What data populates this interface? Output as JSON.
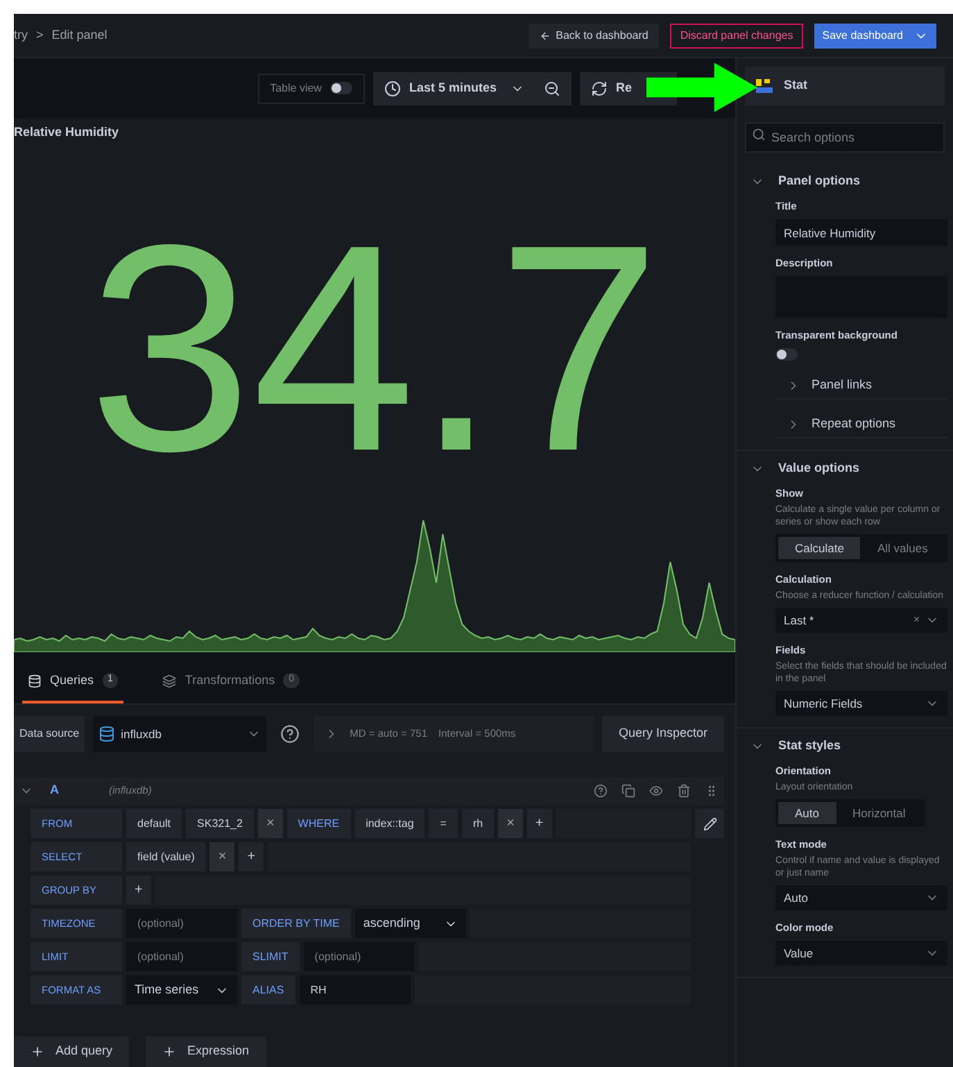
{
  "breadcrumb": {
    "parent": "try",
    "separator": ">",
    "current": "Edit panel"
  },
  "header_buttons": [
    {
      "kind": "back",
      "label": "Back to dashboard"
    },
    {
      "kind": "discard",
      "label": "Discard panel changes"
    },
    {
      "kind": "save",
      "label": "Save dashboard"
    }
  ],
  "toolbar": {
    "table_view": {
      "label": "Table view",
      "on": false
    },
    "time_range": "Last 5 minutes",
    "refresh": "Re"
  },
  "visualization": "Stat",
  "panel": {
    "title": "Relative Humidity",
    "value": "34.7"
  },
  "tabs": [
    {
      "label": "Queries",
      "count": "1",
      "selected": true
    },
    {
      "label": "Transformations",
      "count": "0",
      "selected": false
    }
  ],
  "data_source": {
    "label": "Data source",
    "name": "influxdb",
    "query_options": "MD = auto = 751",
    "interval": "Interval = 500ms",
    "inspector": "Query Inspector"
  },
  "query": {
    "ref": "A",
    "datasource": "(influxdb)",
    "expanded": true,
    "rows": [
      {
        "label": "FROM",
        "parts": [
          {
            "kind": "value",
            "text": "default"
          },
          {
            "kind": "value",
            "text": "SK321_2"
          },
          {
            "kind": "remove",
            "text": "×"
          },
          {
            "kind": "keyword",
            "text": "WHERE"
          },
          {
            "kind": "value",
            "text": "index::tag"
          },
          {
            "kind": "value",
            "text": "="
          },
          {
            "kind": "value",
            "text": "rh"
          },
          {
            "kind": "remove",
            "text": "×"
          },
          {
            "kind": "add",
            "text": "+"
          },
          {
            "kind": "edit"
          }
        ]
      },
      {
        "label": "SELECT",
        "parts": [
          {
            "kind": "value",
            "text": "field (value)"
          },
          {
            "kind": "remove",
            "text": "×"
          },
          {
            "kind": "add",
            "text": "+"
          }
        ]
      },
      {
        "label": "GROUP BY",
        "parts": [
          {
            "kind": "add",
            "text": "+"
          }
        ]
      },
      {
        "label": "TIMEZONE",
        "parts": [
          {
            "kind": "input",
            "placeholder": "(optional)"
          },
          {
            "kind": "keyword",
            "text": "ORDER BY TIME"
          },
          {
            "kind": "select",
            "text": "ascending"
          }
        ]
      },
      {
        "label": "LIMIT",
        "parts": [
          {
            "kind": "input",
            "placeholder": "(optional)"
          },
          {
            "kind": "keyword",
            "text": "SLIMIT"
          },
          {
            "kind": "input",
            "placeholder": "(optional)"
          }
        ]
      },
      {
        "label": "FORMAT AS",
        "parts": [
          {
            "kind": "select",
            "text": "Time series"
          },
          {
            "kind": "keyword",
            "text": "ALIAS"
          },
          {
            "kind": "input",
            "value": "RH"
          }
        ]
      }
    ]
  },
  "query_actions": [
    "Add query",
    "Expression"
  ],
  "options": {
    "search_placeholder": "Search options",
    "sections": [
      {
        "title": "Panel options",
        "expanded": true,
        "items": [
          {
            "kind": "text",
            "label": "Title",
            "value": "Relative Humidity"
          },
          {
            "kind": "textarea",
            "label": "Description"
          },
          {
            "kind": "switch",
            "label": "Transparent background",
            "on": false
          },
          {
            "kind": "group",
            "label": "Panel links",
            "expanded": false
          },
          {
            "kind": "group",
            "label": "Repeat options",
            "expanded": false
          }
        ]
      },
      {
        "title": "Value options",
        "expanded": true,
        "items": [
          {
            "kind": "radio",
            "label": "Show",
            "description": "Calculate a single value per column or series or show each row",
            "options": [
              {
                "label": "Calculate",
                "selected": true
              },
              {
                "label": "All values",
                "selected": false
              }
            ]
          },
          {
            "kind": "select",
            "label": "Calculation",
            "description": "Choose a reducer function / calculation",
            "value": "Last *",
            "clear": "×"
          },
          {
            "kind": "select",
            "label": "Fields",
            "description": "Select the fields that should be included in the panel",
            "value": "Numeric Fields"
          }
        ]
      },
      {
        "title": "Stat styles",
        "expanded": true,
        "items": [
          {
            "kind": "radio",
            "label": "Orientation",
            "description": "Layout orientation",
            "options": [
              {
                "label": "Auto",
                "selected": true
              },
              {
                "label": "Horizontal",
                "selected": false
              }
            ]
          },
          {
            "kind": "select",
            "label": "Text mode",
            "description": "Control if name and value is displayed or just name",
            "value": "Auto"
          },
          {
            "kind": "select",
            "label": "Color mode",
            "value": "Value"
          }
        ]
      }
    ]
  }
}
